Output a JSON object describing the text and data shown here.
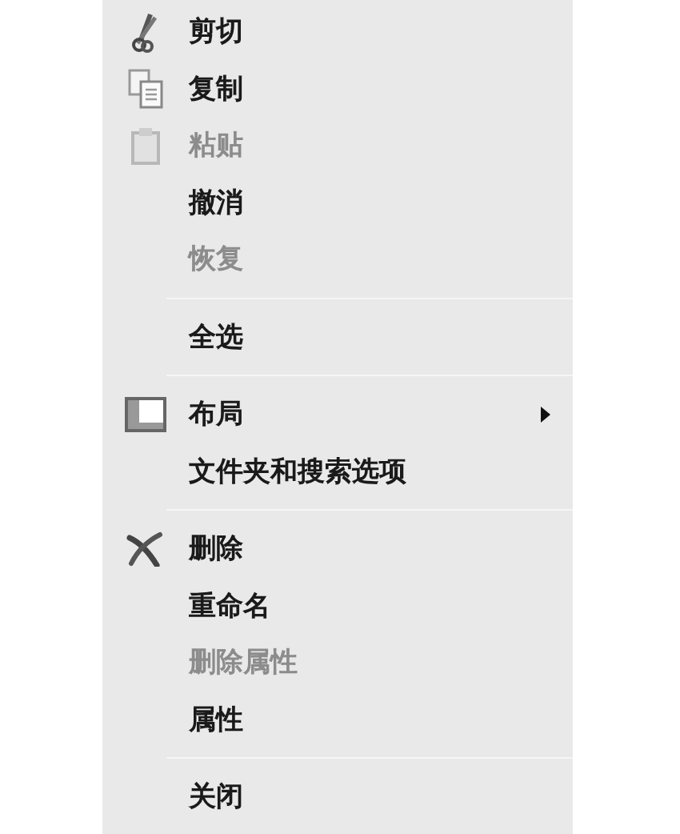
{
  "menu_groups": [
    {
      "items": [
        {
          "label": "剪切",
          "kind": "scissors",
          "disabled": false,
          "submenu": false
        },
        {
          "label": "复制",
          "kind": "copy",
          "disabled": false,
          "submenu": false
        },
        {
          "label": "粘贴",
          "kind": "paste",
          "disabled": true,
          "submenu": false
        },
        {
          "label": "撤消",
          "disabled": false,
          "submenu": false
        },
        {
          "label": "恢复",
          "disabled": true,
          "submenu": false
        }
      ]
    },
    {
      "items": [
        {
          "label": "全选",
          "disabled": false,
          "submenu": false
        }
      ]
    },
    {
      "items": [
        {
          "label": "布局",
          "kind": "layout",
          "disabled": false,
          "submenu": true
        },
        {
          "label": "文件夹和搜索选项",
          "disabled": false,
          "submenu": false
        }
      ]
    },
    {
      "items": [
        {
          "label": "删除",
          "kind": "delete",
          "disabled": false,
          "submenu": false
        },
        {
          "label": "重命名",
          "disabled": false,
          "submenu": false
        },
        {
          "label": "删除属性",
          "disabled": true,
          "submenu": false
        },
        {
          "label": "属性",
          "disabled": false,
          "submenu": false
        }
      ]
    },
    {
      "items": [
        {
          "label": "关闭",
          "disabled": false,
          "submenu": false
        }
      ]
    }
  ]
}
